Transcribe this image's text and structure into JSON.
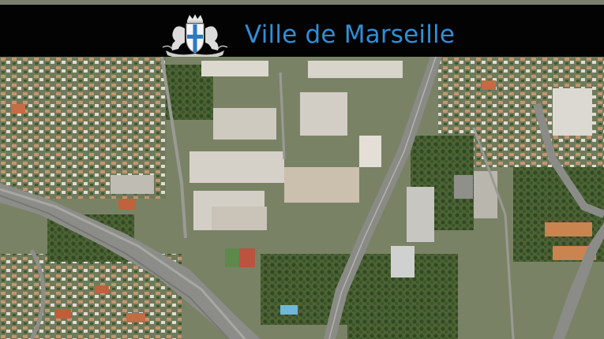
{
  "header": {
    "title": "Ville de Marseille",
    "crest_icon": "city-coat-of-arms-icon"
  },
  "colors": {
    "header_bg": "#030303",
    "title": "#2f8fd8"
  },
  "photo": {
    "subject": "aerial-view-urban-district"
  }
}
